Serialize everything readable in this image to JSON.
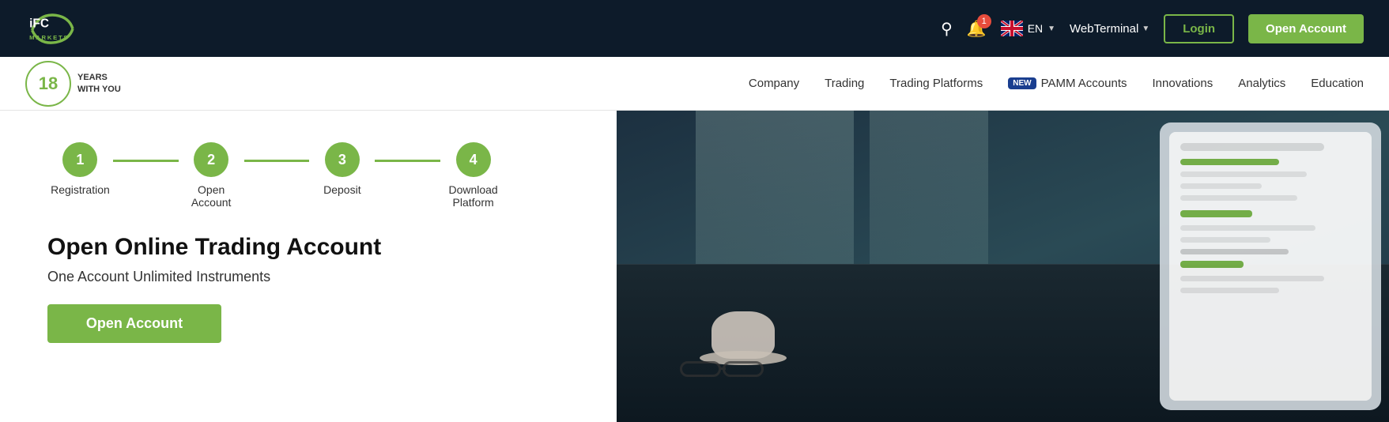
{
  "topbar": {
    "login_label": "Login",
    "open_account_label": "Open Account",
    "lang": "EN",
    "web_terminal_label": "WebTerminal",
    "bell_count": "1"
  },
  "navbar": {
    "years_number": "18",
    "years_line1": "YEARS",
    "years_line2": "WITH YOU",
    "links": [
      {
        "id": "company",
        "label": "Company"
      },
      {
        "id": "trading",
        "label": "Trading"
      },
      {
        "id": "trading-platforms",
        "label": "Trading Platforms"
      },
      {
        "id": "pamm-new-badge",
        "label": "NEW"
      },
      {
        "id": "pamm-accounts",
        "label": "PAMM Accounts"
      },
      {
        "id": "innovations",
        "label": "Innovations"
      },
      {
        "id": "analytics",
        "label": "Analytics"
      },
      {
        "id": "education",
        "label": "Education"
      }
    ]
  },
  "steps": [
    {
      "num": "1",
      "label": "Registration"
    },
    {
      "num": "2",
      "label": "Open Account"
    },
    {
      "num": "3",
      "label": "Deposit"
    },
    {
      "num": "4",
      "label": "Download Platform"
    }
  ],
  "hero": {
    "title": "Open Online Trading Account",
    "subtitle": "One Account Unlimited Instruments",
    "open_account_btn": "Open Account"
  }
}
